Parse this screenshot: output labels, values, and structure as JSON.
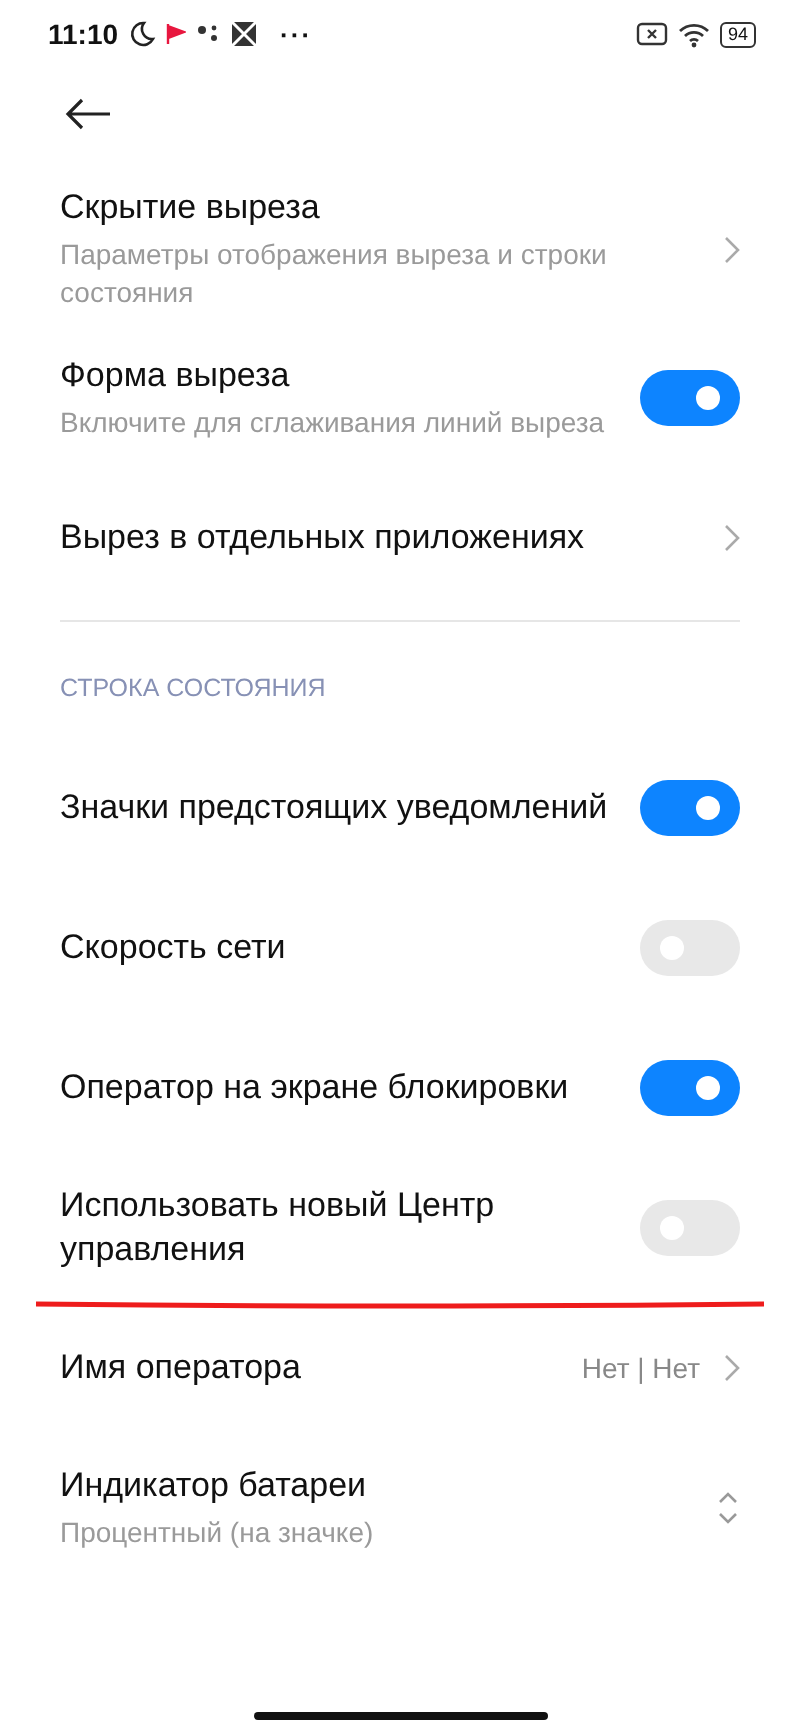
{
  "status_bar": {
    "time": "11:10",
    "more": "···",
    "battery": "94"
  },
  "items": [
    {
      "kind": "link",
      "title": "Скрытие выреза",
      "subtitle": "Параметры отображения выреза и строки состояния"
    },
    {
      "kind": "toggle",
      "title": "Форма выреза",
      "subtitle": "Включите для сглаживания линий выреза",
      "on": true
    },
    {
      "kind": "link",
      "title": "Вырез в отдельных приложениях"
    },
    {
      "kind": "divider"
    },
    {
      "kind": "section",
      "title": "СТРОКА СОСТОЯНИЯ"
    },
    {
      "kind": "toggle",
      "title": "Значки предстоящих уведомлений",
      "on": true
    },
    {
      "kind": "toggle",
      "title": "Скорость сети",
      "on": false
    },
    {
      "kind": "toggle",
      "title": "Оператор на экране блокировки",
      "on": true
    },
    {
      "kind": "toggle",
      "title": "Использовать новый Центр управления",
      "on": false,
      "underlined": true
    },
    {
      "kind": "link",
      "title": "Имя оператора",
      "value": "Нет | Нет"
    },
    {
      "kind": "select",
      "title": "Индикатор батареи",
      "subtitle": "Процентный (на значке)"
    }
  ]
}
